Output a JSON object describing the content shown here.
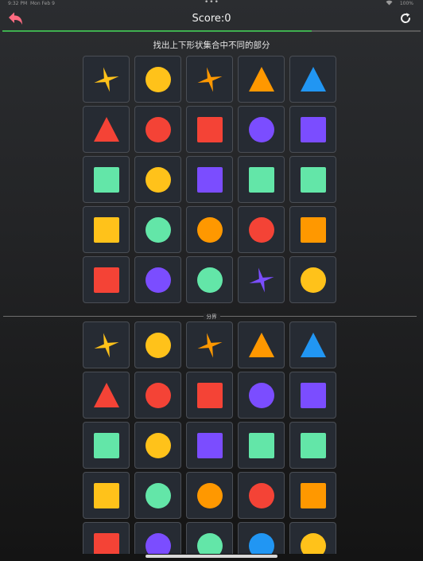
{
  "status_bar": {
    "time": "9:32 PM",
    "date": "Mon Feb 9",
    "battery": "100%"
  },
  "header": {
    "score_label": "Score:0",
    "progress": 0.74
  },
  "instruction": "找出上下形状集合中不同的部分",
  "divider_label": "分界",
  "colors": {
    "yellow": "#ffc21a",
    "orange": "#ff9800",
    "red": "#f44336",
    "blue": "#2196f3",
    "purple": "#7b4dff",
    "green": "#63e6a8",
    "back_icon": "#ff6b81",
    "progress_fill": "#3fb04f"
  },
  "top_grid": [
    [
      {
        "shape": "pinwheel",
        "color": "yellow"
      },
      {
        "shape": "circle",
        "color": "yellow"
      },
      {
        "shape": "pinwheel",
        "color": "orange"
      },
      {
        "shape": "triangle",
        "color": "orange"
      },
      {
        "shape": "triangle",
        "color": "blue"
      }
    ],
    [
      {
        "shape": "triangle",
        "color": "red"
      },
      {
        "shape": "circle",
        "color": "red"
      },
      {
        "shape": "square",
        "color": "red"
      },
      {
        "shape": "circle",
        "color": "purple"
      },
      {
        "shape": "square",
        "color": "purple"
      }
    ],
    [
      {
        "shape": "square",
        "color": "green"
      },
      {
        "shape": "circle",
        "color": "yellow"
      },
      {
        "shape": "square",
        "color": "purple"
      },
      {
        "shape": "square",
        "color": "green"
      },
      {
        "shape": "square",
        "color": "green"
      }
    ],
    [
      {
        "shape": "square",
        "color": "yellow"
      },
      {
        "shape": "circle",
        "color": "green"
      },
      {
        "shape": "circle",
        "color": "orange"
      },
      {
        "shape": "circle",
        "color": "red"
      },
      {
        "shape": "square",
        "color": "orange"
      }
    ],
    [
      {
        "shape": "square",
        "color": "red"
      },
      {
        "shape": "circle",
        "color": "purple"
      },
      {
        "shape": "circle",
        "color": "green"
      },
      {
        "shape": "pinwheel",
        "color": "purple"
      },
      {
        "shape": "circle",
        "color": "yellow"
      }
    ]
  ],
  "bottom_grid": [
    [
      {
        "shape": "pinwheel",
        "color": "yellow"
      },
      {
        "shape": "circle",
        "color": "yellow"
      },
      {
        "shape": "pinwheel",
        "color": "orange"
      },
      {
        "shape": "triangle",
        "color": "orange"
      },
      {
        "shape": "triangle",
        "color": "blue"
      }
    ],
    [
      {
        "shape": "triangle",
        "color": "red"
      },
      {
        "shape": "circle",
        "color": "red"
      },
      {
        "shape": "square",
        "color": "red"
      },
      {
        "shape": "circle",
        "color": "purple"
      },
      {
        "shape": "square",
        "color": "purple"
      }
    ],
    [
      {
        "shape": "square",
        "color": "green"
      },
      {
        "shape": "circle",
        "color": "yellow"
      },
      {
        "shape": "square",
        "color": "purple"
      },
      {
        "shape": "square",
        "color": "green"
      },
      {
        "shape": "square",
        "color": "green"
      }
    ],
    [
      {
        "shape": "square",
        "color": "yellow"
      },
      {
        "shape": "circle",
        "color": "green"
      },
      {
        "shape": "circle",
        "color": "orange"
      },
      {
        "shape": "circle",
        "color": "red"
      },
      {
        "shape": "square",
        "color": "orange"
      }
    ],
    [
      {
        "shape": "square",
        "color": "red"
      },
      {
        "shape": "circle",
        "color": "purple"
      },
      {
        "shape": "circle",
        "color": "green"
      },
      {
        "shape": "circle",
        "color": "blue"
      },
      {
        "shape": "circle",
        "color": "yellow"
      }
    ]
  ]
}
